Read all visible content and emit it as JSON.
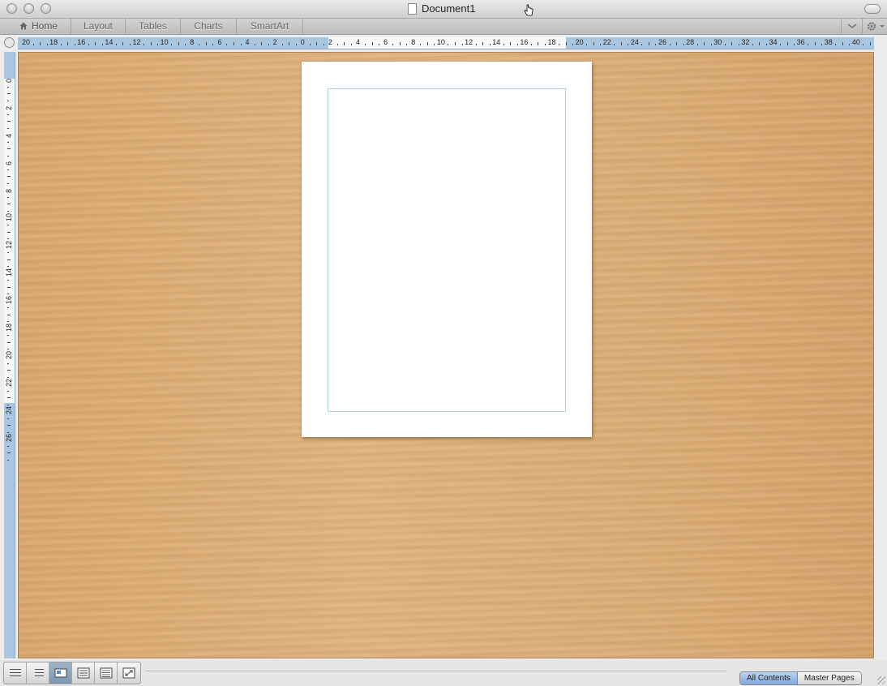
{
  "window": {
    "title": "Document1"
  },
  "ribbon": {
    "tabs": [
      {
        "label": "Home"
      },
      {
        "label": "Layout"
      },
      {
        "label": "Tables"
      },
      {
        "label": "Charts"
      },
      {
        "label": "SmartArt"
      }
    ]
  },
  "ruler": {
    "horizontal_labels": [
      "20",
      "18",
      "16",
      "14",
      "12",
      "10",
      "8",
      "6",
      "4",
      "2",
      "0",
      "2",
      "4",
      "6",
      "8",
      "10",
      "12",
      "14",
      "16",
      "18",
      "20",
      "22",
      "24",
      "26",
      "28",
      "30",
      "32",
      "34",
      "36",
      "38",
      "40"
    ],
    "vertical_labels": [
      "0",
      "2",
      "4",
      "6",
      "8",
      "10",
      "12",
      "14",
      "16",
      "18",
      "20",
      "22",
      "24",
      "26"
    ]
  },
  "footer": {
    "views": [
      "Draft view",
      "Outline view",
      "Publishing layout view",
      "Print layout view",
      "Notebook layout view",
      "Full screen view"
    ],
    "active_view_index": 2,
    "tabs": [
      {
        "label": "All Contents",
        "active": true
      },
      {
        "label": "Master Pages",
        "active": false
      }
    ]
  }
}
